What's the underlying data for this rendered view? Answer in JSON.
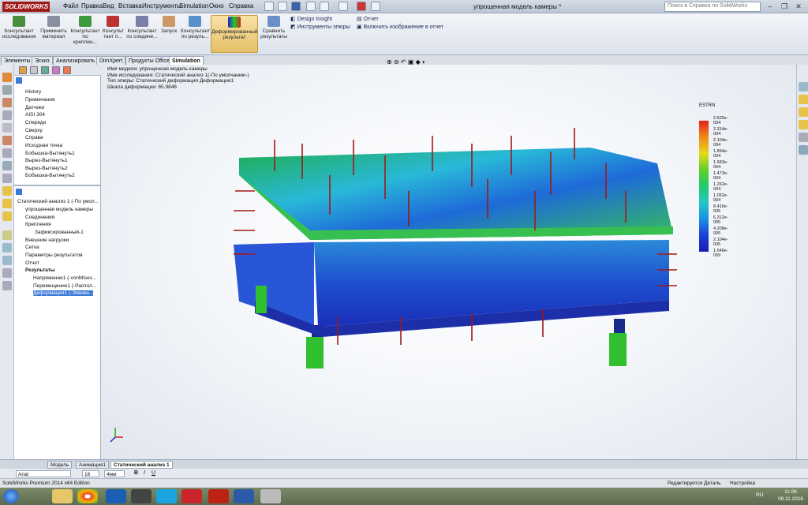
{
  "app": {
    "logo": "SOLIDWORKS",
    "doc_title": "упрощенная модель камеры *",
    "help_placeholder": "Поиск в Справка по SolidWorks"
  },
  "menu": [
    "Файл",
    "Правка",
    "Вид",
    "Вставка",
    "Инструменты",
    "Simulation",
    "Окно",
    "Справка"
  ],
  "ribbon": {
    "buttons": [
      "Консультант исследования",
      "Применить материал",
      "Консультант по креплен...",
      "Консульт тант п...",
      "Консультант по соедине...",
      "Запуск",
      "Консультант по резуль...",
      "Деформированный результат",
      "Сравнить результаты"
    ],
    "side": [
      "Design Insight",
      "Инструменты эпюры",
      "Отчет",
      "Включить изображение в отчет"
    ]
  },
  "tabs": [
    "Элементы",
    "Эскиз",
    "Анализировать",
    "DimXpert",
    "Продукты Office",
    "Simulation"
  ],
  "tree_top": [
    "History",
    "Примечания",
    "Датчики",
    "AISI 304",
    "Спереди",
    "Сверху",
    "Справа",
    "Исходная точка",
    "Бобышка-Вытянуть1",
    "Вырез-Вытянуть1",
    "Вырез-Вытянуть2",
    "Бобышка-Вытянуть2"
  ],
  "tree_bottom": [
    "Статический анализ 1 (-По умол...",
    "упрощенная модель камеры",
    "Соединения",
    "Крепления",
    "Зафиксированный-1",
    "Внешние нагрузки",
    "Сетка",
    "Параметры результатов",
    "Отчет",
    "Результаты",
    "Напряжение1 (-vonMises...",
    "Перемещение1 (-Распол...",
    "Деформация1 (-Эквива..."
  ],
  "info": [
    "Имя модели: упрощенная модель камеры",
    "Имя исследования: Статический анализ 1(-По умолчанию-)",
    "Тип эпюры: Статический деформация Деформация1",
    "Шкала деформации: 65.9846"
  ],
  "legend": {
    "title": "ESTRN",
    "values": [
      "2.525e-004",
      "2.314e-004",
      "2.104e-004",
      "1.894e-004",
      "1.683e-004",
      "1.473e-004",
      "1.262e-004",
      "1.052e-004",
      "8.416e-005",
      "6.312e-005",
      "4.208e-005",
      "2.104e-005",
      "1.648e-009"
    ]
  },
  "bottom_tabs": [
    "Модель",
    "Анимация1",
    "Статический анализ 1"
  ],
  "font_bar": {
    "font": "Arial",
    "size": "16",
    "unit": "4мм"
  },
  "status": {
    "left": "SolidWorks Premium 2014 x64 Edition",
    "edit": "Редактируется Деталь",
    "settings": "Настройка"
  },
  "clock": {
    "time": "11:06",
    "date": "08.11.2016",
    "lang": "RU"
  },
  "colors": {
    "ribbon_active": "#e6c06a",
    "selection": "#3b78d8"
  }
}
